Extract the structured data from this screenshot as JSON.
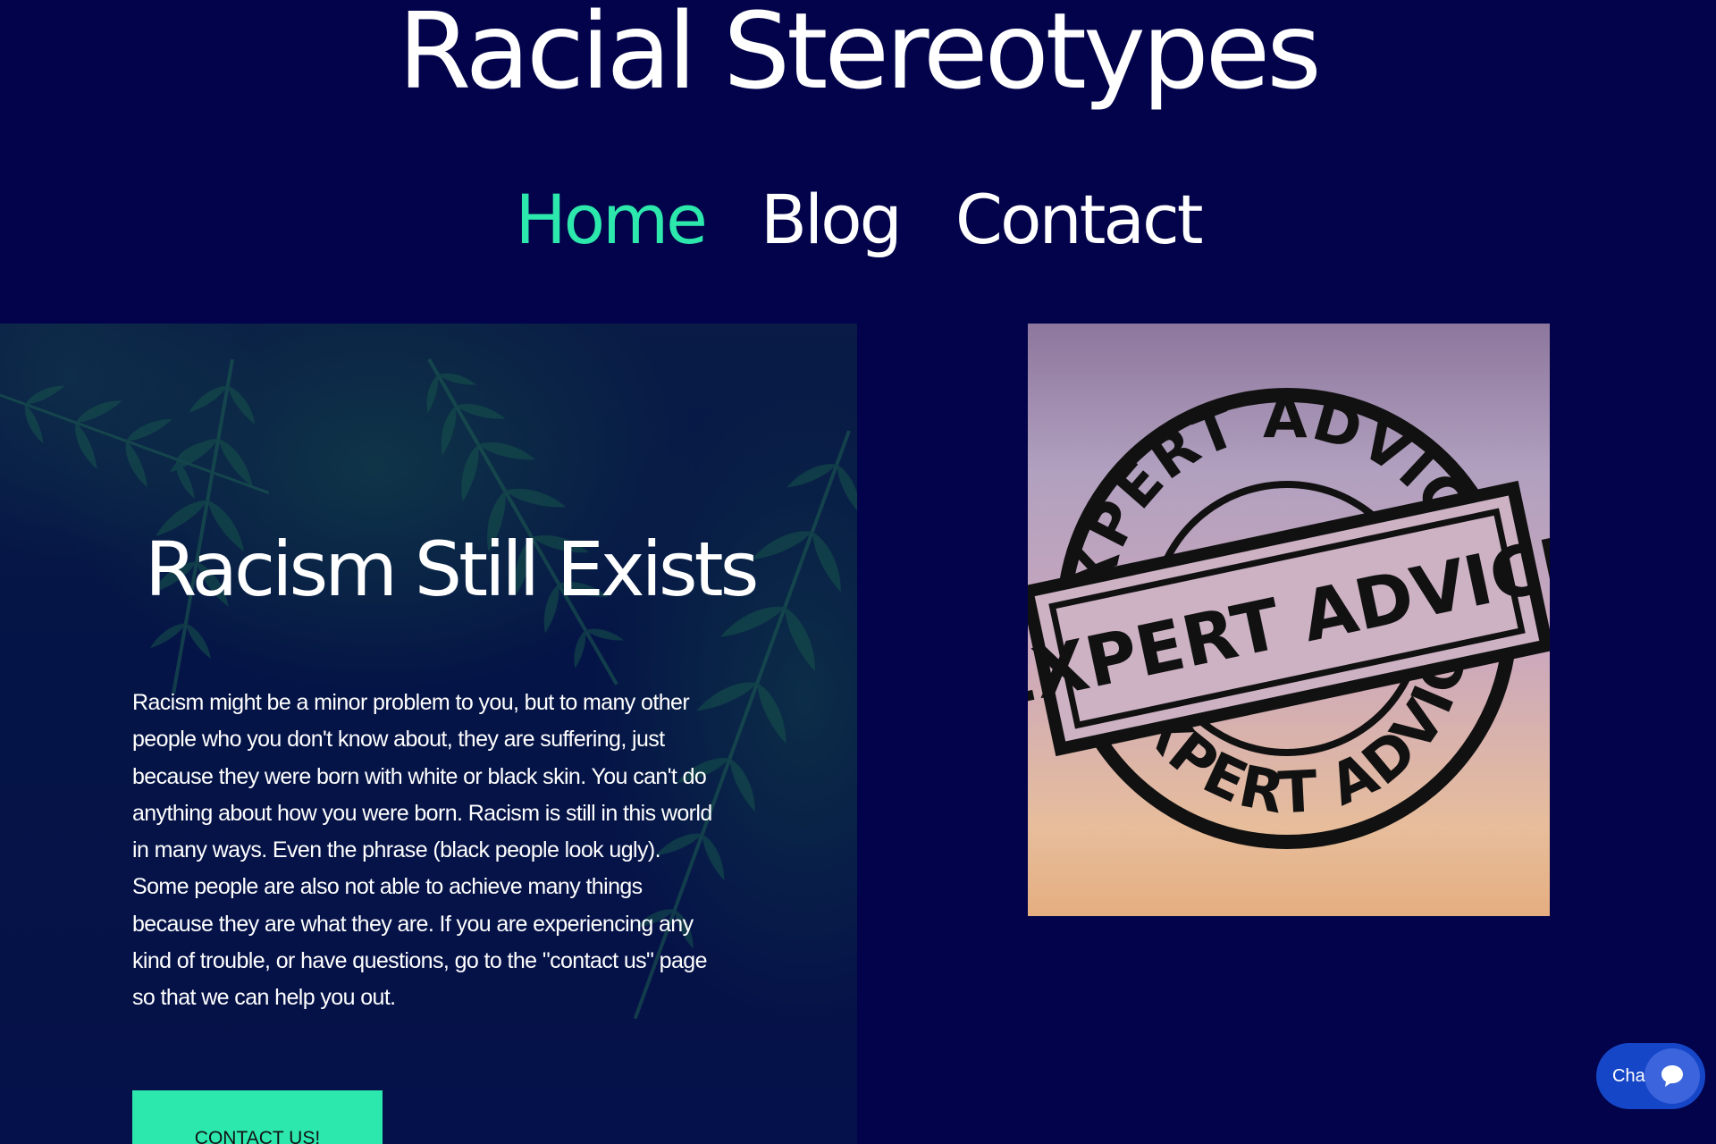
{
  "site": {
    "title": "Racial Stereotypes"
  },
  "nav": {
    "items": [
      {
        "label": "Home",
        "active": true
      },
      {
        "label": "Blog",
        "active": false
      },
      {
        "label": "Contact",
        "active": false
      }
    ],
    "active_color": "#2de8ad"
  },
  "hero": {
    "heading": "Racism Still Exists",
    "body": "Racism might be a minor problem to you, but to many other people who you don't know about, they are suffering, just because they were born with white or black skin. You can't do anything about how you were born. Racism is still in this world in many ways. Even the phrase (black people look ugly). Some people are also not able to achieve many things because they are what they are. If you are experiencing any kind of trouble, or have questions, go to the \"contact us\" page so that we can help you out.",
    "cta_label": "CONTACT US!",
    "cta_color": "#2de8ad"
  },
  "stamp_image": {
    "outer_ring_top": "EXPERT ADVICE",
    "outer_ring_bottom": "EXPERT ADVICE",
    "banner": "EXPERT ADVICE"
  },
  "chat": {
    "label": "Chat",
    "icon": "chat-bubble-icon"
  },
  "colors": {
    "background": "#02034a",
    "accent": "#2de8ad",
    "chat": "#1646c8"
  }
}
